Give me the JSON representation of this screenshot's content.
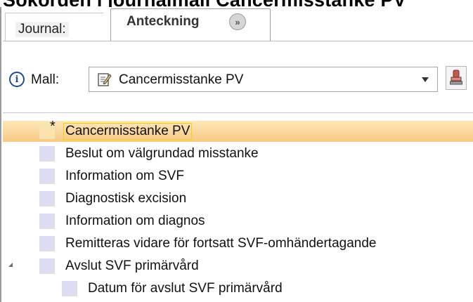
{
  "page_title": "Sökorden i journalmall Cancermisstanke PV",
  "tabs": [
    {
      "label": "Journal:"
    },
    {
      "label": "Anteckning"
    }
  ],
  "template": {
    "label": "Mall:",
    "selected": "Cancermisstanke PV"
  },
  "tree": {
    "root": {
      "label": "Cancermisstanke PV",
      "marker": "*"
    },
    "items": [
      {
        "label": "Beslut om välgrundad misstanke"
      },
      {
        "label": "Information om SVF"
      },
      {
        "label": "Diagnostisk excision"
      },
      {
        "label": "Information om diagnos"
      },
      {
        "label": "Remitteras vidare för fortsatt SVF-omhändertagande"
      },
      {
        "label": "Avslut SVF primärvård"
      }
    ],
    "child": {
      "label": "Datum för avslut SVF primärvård"
    }
  },
  "icons": {
    "tab_more": "double-chevron-right-icon",
    "info": "info-icon",
    "template": "template-edit-icon",
    "dropdown": "dropdown-arrow-icon",
    "stamp": "stamp-icon",
    "expand": "expanded-triangle-icon"
  },
  "colors": {
    "selection": "#f7c984",
    "tree_marker": "#dcdcf2",
    "focus_border": "#f2d400",
    "info_blue": "#1f4e8c"
  }
}
